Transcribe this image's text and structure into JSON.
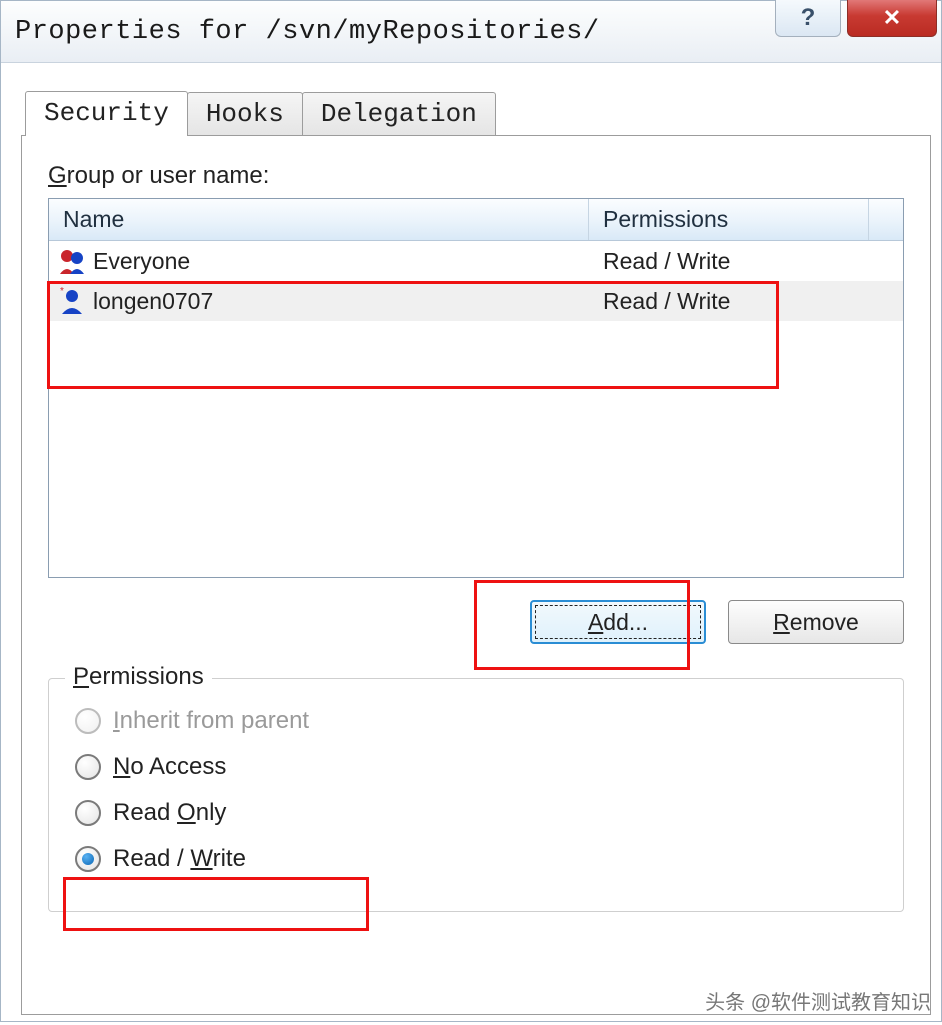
{
  "titlebar": {
    "title": "Properties for /svn/myRepositories/",
    "help_glyph": "?",
    "close_glyph": "✕"
  },
  "tabs": {
    "security": "Security",
    "hooks": "Hooks",
    "delegation": "Delegation"
  },
  "security": {
    "group_label_prefix": "G",
    "group_label_rest": "roup or user name:",
    "columns": {
      "name": "Name",
      "permissions": "Permissions"
    },
    "rows": [
      {
        "icon": "group",
        "name": "Everyone",
        "perm": "Read / Write",
        "selected": false
      },
      {
        "icon": "user",
        "name": "longen0707",
        "perm": "Read / Write",
        "selected": true
      }
    ],
    "buttons": {
      "add_prefix": "A",
      "add_rest": "dd...",
      "remove_prefix": "R",
      "remove_rest": "emove"
    }
  },
  "permissions": {
    "legend_prefix": "P",
    "legend_rest": "ermissions",
    "inherit_prefix": "I",
    "inherit_rest": "nherit from parent",
    "noaccess_prefix": "N",
    "noaccess_rest": "o Access",
    "readonly_pre": "Read ",
    "readonly_u": "O",
    "readonly_post": "nly",
    "readwrite_pre": "Read / ",
    "readwrite_u": "W",
    "readwrite_post": "rite"
  },
  "watermark": "头条 @软件测试教育知识"
}
